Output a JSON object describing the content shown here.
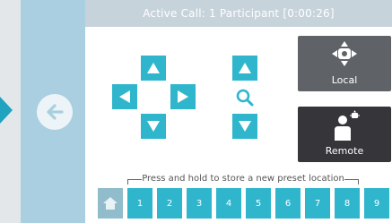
{
  "title": "Active Call: 1 Participant [0:00:26]",
  "camera": {
    "local_label": "Local",
    "remote_label": "Remote"
  },
  "presets": {
    "hint": "Press and hold to store a new preset location",
    "items": [
      "1",
      "2",
      "3",
      "4",
      "5",
      "6",
      "7",
      "8",
      "9"
    ]
  },
  "colors": {
    "accent": "#2fb6cd",
    "title_bar": "#c7d3da",
    "side_panel": "#a9cfe0",
    "local_button": "#5f6368",
    "remote_button": "#35353a"
  },
  "icons": [
    "back-arrow-icon",
    "arrow-up-icon",
    "arrow-down-icon",
    "arrow-left-icon",
    "arrow-right-icon",
    "zoom-magnifier-icon",
    "local-camera-icon",
    "remote-person-icon",
    "home-icon"
  ]
}
